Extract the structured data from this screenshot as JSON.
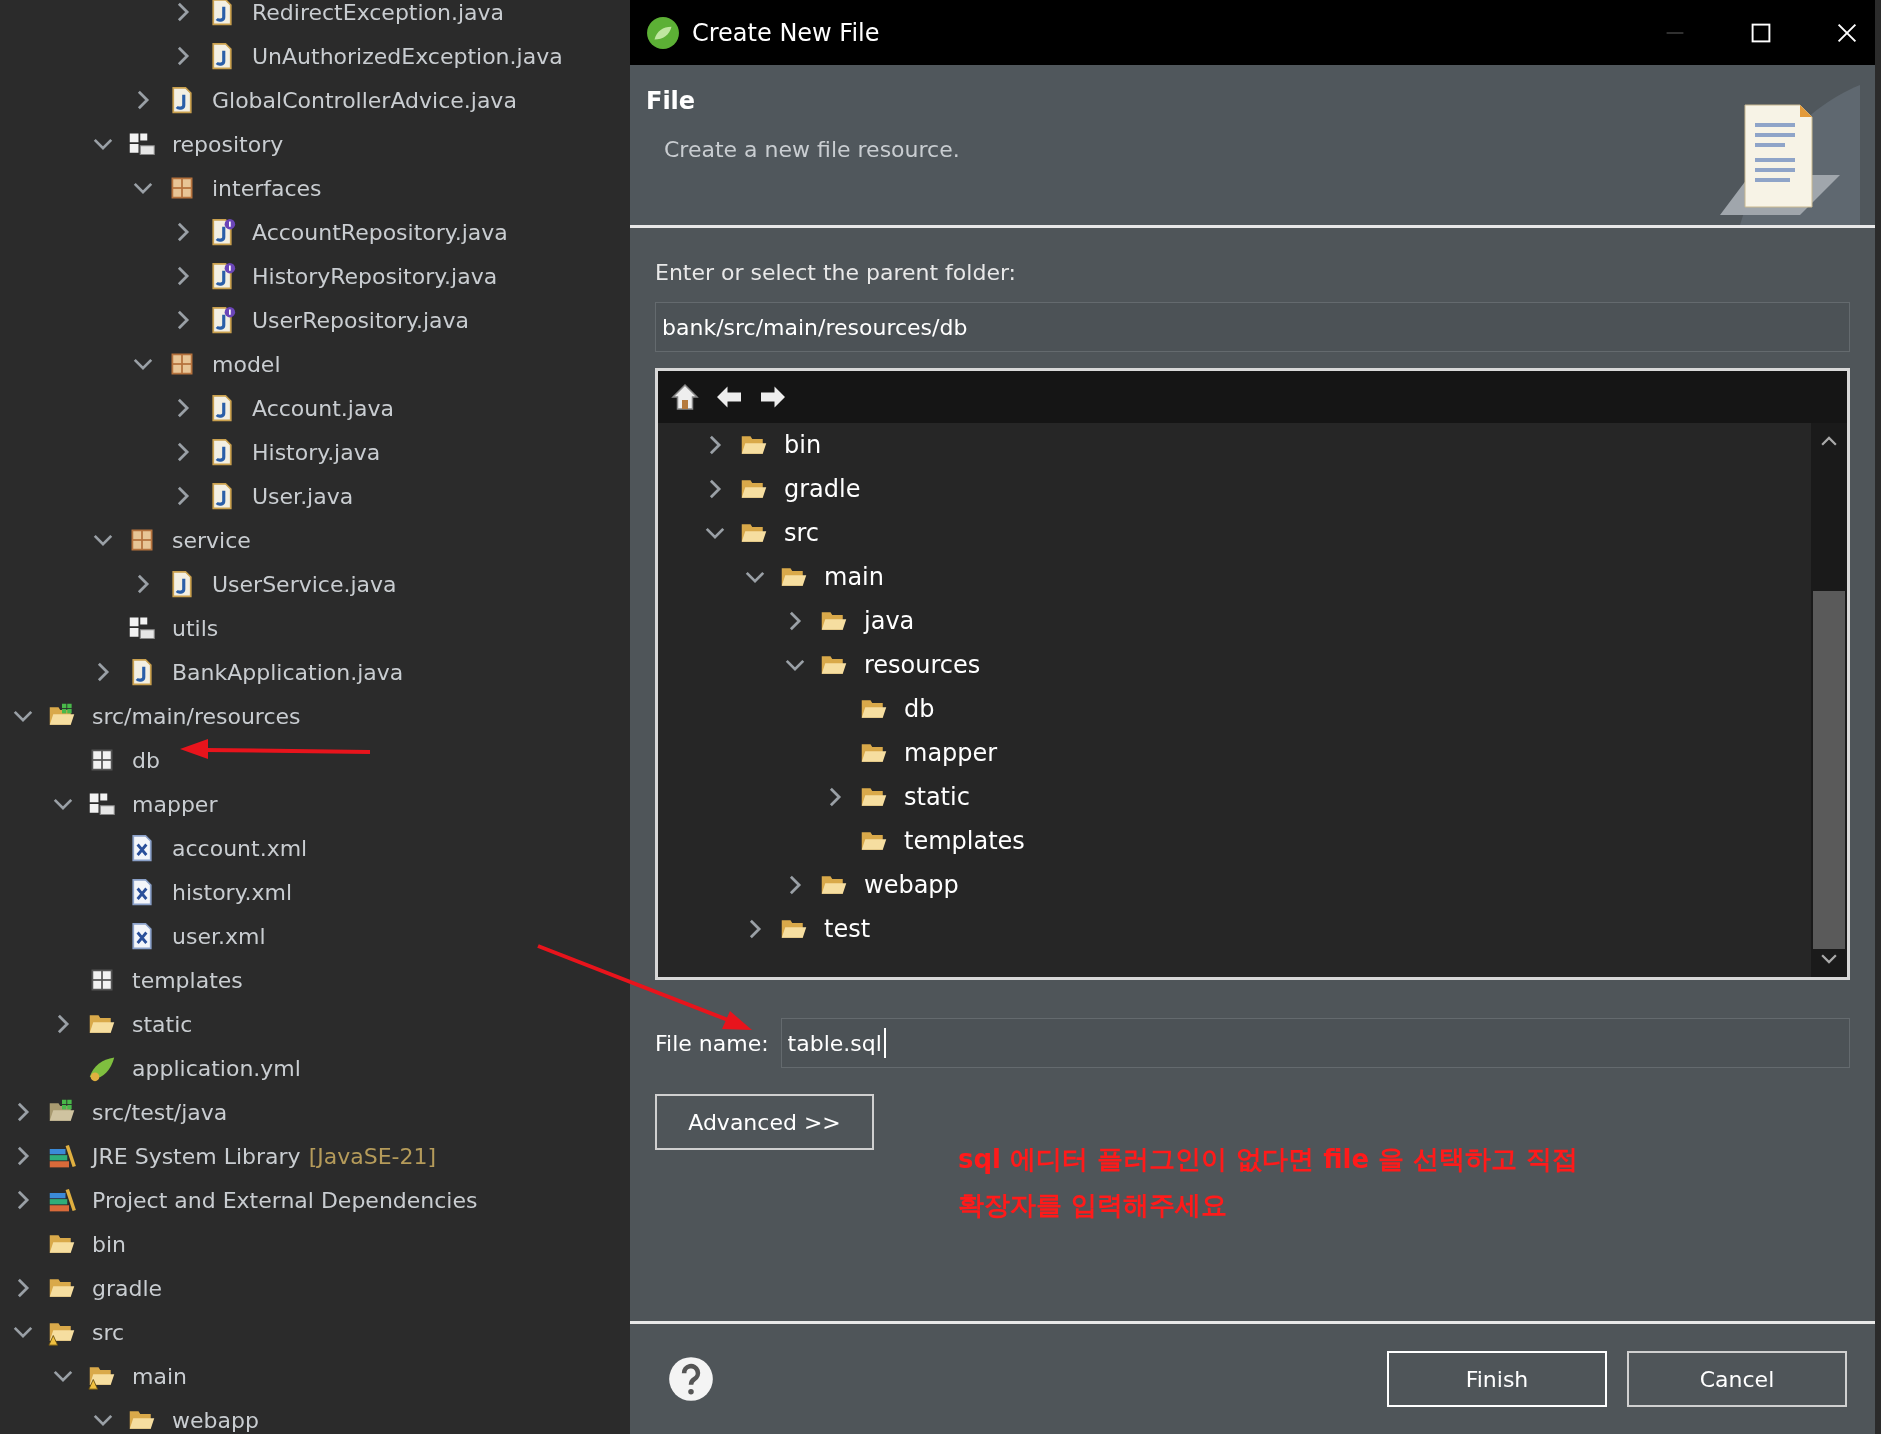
{
  "explorer": {
    "items": [
      {
        "children": [
          {
            "children": [
              {
                "children": [
                  {
                    "children": [
                      {
                        "label": "RedirectException.java",
                        "kind": "java",
                        "expanded": false
                      },
                      {
                        "label": "UnAuthorizedException.java",
                        "kind": "java",
                        "expanded": false
                      }
                    ]
                  },
                  {
                    "label": "GlobalControllerAdvice.java",
                    "kind": "java",
                    "expanded": false
                  }
                ]
              },
              {
                "label": "repository",
                "kind": "package-folder",
                "expanded": true,
                "children": [
                  {
                    "label": "interfaces",
                    "kind": "package",
                    "expanded": true,
                    "children": [
                      {
                        "label": "AccountRepository.java",
                        "kind": "interface",
                        "expanded": false
                      },
                      {
                        "label": "HistoryRepository.java",
                        "kind": "interface",
                        "expanded": false
                      },
                      {
                        "label": "UserRepository.java",
                        "kind": "interface",
                        "expanded": false
                      }
                    ]
                  },
                  {
                    "label": "model",
                    "kind": "package",
                    "expanded": true,
                    "children": [
                      {
                        "label": "Account.java",
                        "kind": "java",
                        "expanded": false
                      },
                      {
                        "label": "History.java",
                        "kind": "java",
                        "expanded": false
                      },
                      {
                        "label": "User.java",
                        "kind": "java",
                        "expanded": false
                      }
                    ]
                  }
                ]
              },
              {
                "label": "service",
                "kind": "package",
                "expanded": true,
                "children": [
                  {
                    "label": "UserService.java",
                    "kind": "java",
                    "expanded": false
                  }
                ]
              },
              {
                "label": "utils",
                "kind": "package-folder"
              },
              {
                "label": "BankApplication.java",
                "kind": "java",
                "expanded": false
              }
            ]
          }
        ]
      },
      {
        "label": "src/main/resources",
        "kind": "source-folder",
        "expanded": true,
        "children": [
          {
            "label": "db",
            "kind": "empty-package"
          },
          {
            "label": "mapper",
            "kind": "package-folder",
            "expanded": true,
            "children": [
              {
                "label": "account.xml",
                "kind": "xml"
              },
              {
                "label": "history.xml",
                "kind": "xml"
              },
              {
                "label": "user.xml",
                "kind": "xml"
              }
            ]
          },
          {
            "label": "templates",
            "kind": "empty-package"
          },
          {
            "label": "static",
            "kind": "folder",
            "expanded": false
          },
          {
            "label": "application.yml",
            "kind": "yml"
          }
        ]
      },
      {
        "label": "src/test/java",
        "kind": "test-folder",
        "expanded": false
      },
      {
        "label": "JRE System Library",
        "decoration": "[JavaSE-21]",
        "kind": "library",
        "expanded": false
      },
      {
        "label": "Project and External Dependencies",
        "kind": "library",
        "expanded": false
      },
      {
        "label": "bin",
        "kind": "folder"
      },
      {
        "label": "gradle",
        "kind": "folder",
        "expanded": false
      },
      {
        "label": "src",
        "kind": "warning-folder",
        "expanded": true,
        "children": [
          {
            "label": "main",
            "kind": "warning-folder",
            "expanded": true,
            "children": [
              {
                "label": "webapp",
                "kind": "folder",
                "expanded": true
              }
            ]
          }
        ]
      }
    ]
  },
  "dialog": {
    "title": "Create New File",
    "header": {
      "title": "File",
      "description": "Create a new file resource."
    },
    "folder_label": "Enter or select the parent folder:",
    "folder_path": "bank/src/main/resources/db",
    "folder_tree": [
      {
        "label": "bin",
        "expanded": false
      },
      {
        "label": "gradle",
        "expanded": false
      },
      {
        "label": "src",
        "expanded": true,
        "children": [
          {
            "label": "main",
            "expanded": true,
            "children": [
              {
                "label": "java",
                "expanded": false
              },
              {
                "label": "resources",
                "expanded": true,
                "children": [
                  {
                    "label": "db"
                  },
                  {
                    "label": "mapper"
                  },
                  {
                    "label": "static",
                    "expanded": false
                  },
                  {
                    "label": "templates"
                  }
                ]
              },
              {
                "label": "webapp",
                "expanded": false
              }
            ]
          },
          {
            "label": "test",
            "expanded": false
          }
        ]
      }
    ],
    "file_name_label": "File name:",
    "file_name": "table.sql",
    "advanced_button": "Advanced >>",
    "note": [
      "sql 에디터 플러그인이 없다면 file 을 선택하고 직접",
      "확장자를 입력해주세요"
    ],
    "buttons": [
      {
        "label": "Finish",
        "kind": "default"
      },
      {
        "label": "Cancel",
        "kind": "normal"
      }
    ]
  }
}
